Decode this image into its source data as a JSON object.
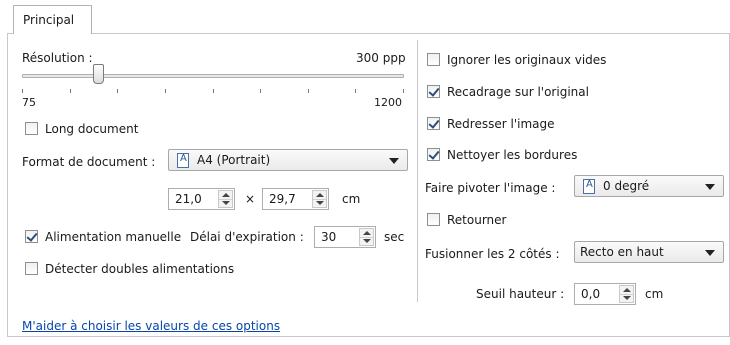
{
  "tabs": [
    {
      "label": "Principal"
    }
  ],
  "resolution": {
    "label": "Résolution :",
    "value_text": "300 ppp",
    "min_label": "75",
    "max_label": "1200",
    "min": 75,
    "max": 1200,
    "value": 300
  },
  "long_document": {
    "label": "Long document",
    "checked": false
  },
  "document_format": {
    "label": "Format de document :",
    "selected": "A4 (Portrait)",
    "icon": "document-icon"
  },
  "dimensions": {
    "width": "21,0",
    "times": "×",
    "height": "29,7",
    "unit": "cm"
  },
  "manual_feed": {
    "label": "Alimentation manuelle",
    "checked": true
  },
  "timeout": {
    "label": "Délai d'expiration :",
    "value": "30",
    "unit": "sec"
  },
  "double_feed": {
    "label": "Détecter doubles alimentations",
    "checked": false
  },
  "right_options": {
    "ignore_blank": {
      "label": "Ignorer les originaux vides",
      "checked": false
    },
    "crop": {
      "label": "Recadrage sur l'original",
      "checked": true
    },
    "straighten": {
      "label": "Redresser l'image",
      "checked": true
    },
    "clean_borders": {
      "label": "Nettoyer les bordures",
      "checked": true
    }
  },
  "rotate": {
    "label": "Faire pivoter l'image :",
    "selected": "0 degré",
    "icon": "document-icon"
  },
  "flip": {
    "label": "Retourner",
    "checked": false
  },
  "merge_sides": {
    "label": "Fusionner les 2 côtés :",
    "selected": "Recto en haut"
  },
  "height_threshold": {
    "label": "Seuil hauteur :",
    "value": "0,0",
    "unit": "cm"
  },
  "help_link": "M'aider à choisir les valeurs de ces options"
}
